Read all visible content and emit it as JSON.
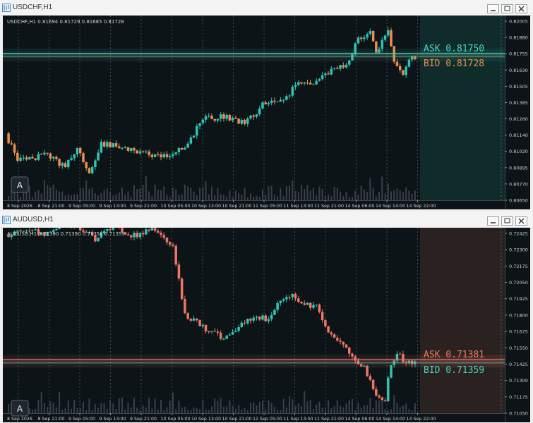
{
  "colors": {
    "bull": "#2fc4b2",
    "bear": "#e8904f",
    "bear2": "#ee7664",
    "chart_bg": "#0c1418",
    "future_zone_1": "#0f2c2b",
    "future_zone_2": "#2a2220"
  },
  "windows": [
    {
      "title": "USDCHF,H1",
      "ohlc_caption": "USDCHF,H1  0.81694 0.81729 0.81685 0.81728",
      "ask_text": "ASK 0.81750",
      "bid_text": "BID 0.81728",
      "ask_value": 0.8175,
      "bid_value": 0.81728,
      "ask_color": "#4fd1bd",
      "bid_color": "#e8904f",
      "line_color": "#3fc6ae",
      "autoscroll_label": "A",
      "ylim": [
        0.8065,
        0.8202
      ],
      "y_ticks": [
        "0.82005",
        "0.81880",
        "0.81755",
        "0.81630",
        "0.81505",
        "0.81385",
        "0.81260",
        "0.81140",
        "0.81020",
        "0.80895",
        "0.80770",
        "0.80650"
      ],
      "x_ticks": [
        "8 Sep 2026",
        "8 Sep 21:00",
        "9 Sep 05:00",
        "9 Sep 13:00",
        "9 Sep 21:00",
        "10 Sep 05:00",
        "10 Sep 13:00",
        "10 Sep 21:00",
        "11 Sep 05:00",
        "11 Sep 13:00",
        "11 Sep 21:00",
        "14 Sep 06:00",
        "14 Sep 14:00",
        "14 Sep 22:00"
      ],
      "chart_data": {
        "type": "candlestick",
        "y_unit": "price",
        "knots": [
          [
            0,
            0.8114
          ],
          [
            4,
            0.8093
          ],
          [
            14,
            0.8098
          ],
          [
            20,
            0.8088
          ],
          [
            24,
            0.8102
          ],
          [
            28,
            0.8082
          ],
          [
            32,
            0.8106
          ],
          [
            42,
            0.8102
          ],
          [
            48,
            0.8097
          ],
          [
            56,
            0.8098
          ],
          [
            60,
            0.8104
          ],
          [
            66,
            0.8125
          ],
          [
            74,
            0.8127
          ],
          [
            80,
            0.8121
          ],
          [
            86,
            0.8136
          ],
          [
            92,
            0.8138
          ],
          [
            98,
            0.8152
          ],
          [
            104,
            0.8154
          ],
          [
            108,
            0.8161
          ],
          [
            114,
            0.8167
          ],
          [
            118,
            0.8185
          ],
          [
            122,
            0.8193
          ],
          [
            124,
            0.8175
          ],
          [
            128,
            0.8192
          ],
          [
            130,
            0.8168
          ],
          [
            133,
            0.8161
          ],
          [
            136,
            0.8172
          ]
        ],
        "count": 137
      }
    },
    {
      "title": "AUDUSD,H1",
      "ohlc_caption": "AUDUSD,H1  0.71390 0.71390 0.71358 0.71359",
      "ask_text": "ASK 0.71381",
      "bid_text": "BID 0.71359",
      "ask_value": 0.71381,
      "bid_value": 0.71359,
      "ask_color": "#ee7664",
      "bid_color": "#4fd1bd",
      "line_color": "#e8836e",
      "autoscroll_label": "A",
      "ylim": [
        0.7104,
        0.7225
      ],
      "y_ticks": [
        "0.72425",
        "0.72300",
        "0.72175",
        "0.72050",
        "0.71925",
        "0.71800",
        "0.71675",
        "0.71550",
        "0.71425",
        "0.71300",
        "0.71175",
        "0.71050"
      ],
      "x_ticks": [
        "8 Sep 2026",
        "8 Sep 21:00",
        "9 Sep 05:00",
        "9 Sep 13:00",
        "9 Sep 21:00",
        "10 Sep 05:00",
        "10 Sep 13:00",
        "10 Sep 21:00",
        "11 Sep 05:00",
        "11 Sep 13:00",
        "11 Sep 21:00",
        "14 Sep 06:00",
        "14 Sep 14:00",
        "14 Sep 22:00"
      ],
      "chart_data": {
        "type": "candlestick",
        "y_unit": "price",
        "knots": [
          [
            0,
            0.7222
          ],
          [
            6,
            0.7226
          ],
          [
            14,
            0.7223
          ],
          [
            20,
            0.7232
          ],
          [
            26,
            0.7226
          ],
          [
            30,
            0.7218
          ],
          [
            36,
            0.7228
          ],
          [
            42,
            0.7221
          ],
          [
            48,
            0.7226
          ],
          [
            52,
            0.7223
          ],
          [
            56,
            0.7214
          ],
          [
            58,
            0.7191
          ],
          [
            60,
            0.7168
          ],
          [
            66,
            0.716
          ],
          [
            72,
            0.7153
          ],
          [
            78,
            0.716
          ],
          [
            84,
            0.7168
          ],
          [
            88,
            0.7164
          ],
          [
            92,
            0.7178
          ],
          [
            96,
            0.7182
          ],
          [
            100,
            0.7175
          ],
          [
            104,
            0.7174
          ],
          [
            108,
            0.7158
          ],
          [
            112,
            0.715
          ],
          [
            116,
            0.7142
          ],
          [
            120,
            0.7132
          ],
          [
            124,
            0.7114
          ],
          [
            127,
            0.7112
          ],
          [
            129,
            0.7136
          ],
          [
            131,
            0.7142
          ],
          [
            134,
            0.7137
          ],
          [
            136,
            0.7136
          ]
        ],
        "count": 137
      }
    }
  ]
}
